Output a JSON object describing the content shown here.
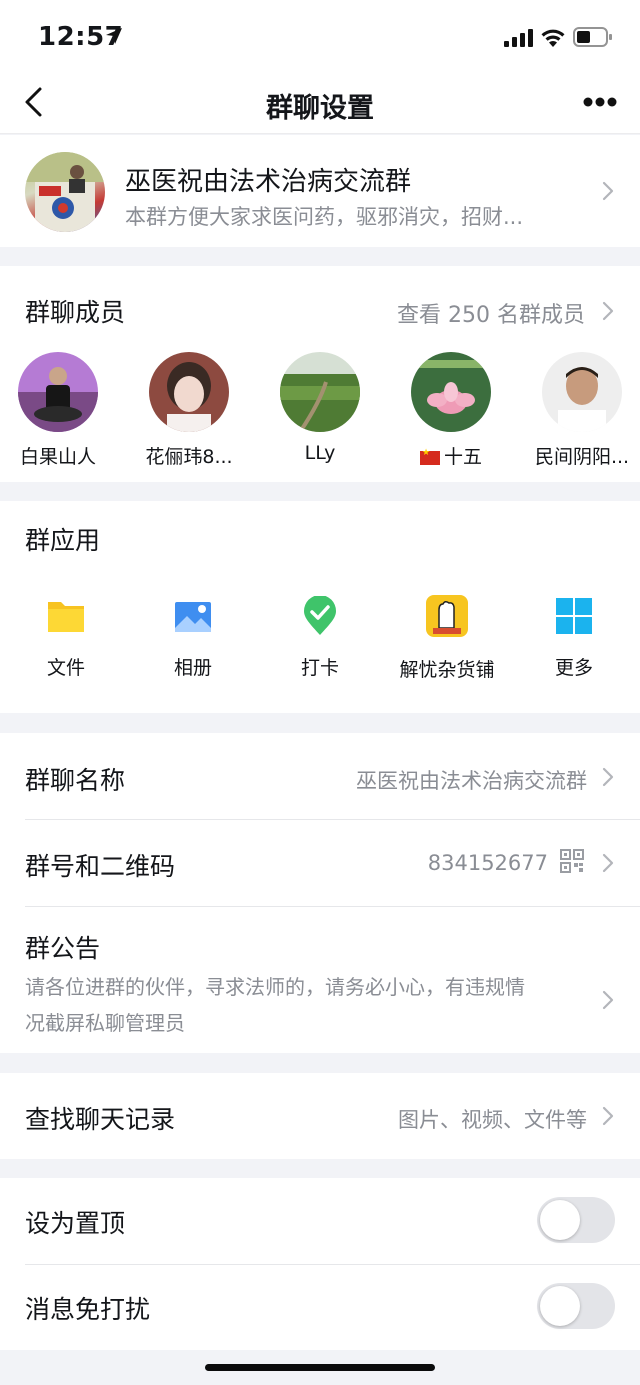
{
  "status_bar": {
    "time": "12:57"
  },
  "nav": {
    "title": "群聊设置"
  },
  "group": {
    "name": "巫医祝由法术治病交流群",
    "description": "本群方便大家求医问药，驱邪消灾，招财..."
  },
  "members": {
    "title": "群聊成员",
    "view_all": "查看 250 名群成员",
    "list": [
      {
        "name": "白果山人"
      },
      {
        "name": "花俪玮8..."
      },
      {
        "name": "LLy"
      },
      {
        "name": "十五"
      },
      {
        "name": "民间阴阳..."
      }
    ]
  },
  "apps": {
    "title": "群应用",
    "items": [
      {
        "label": "文件"
      },
      {
        "label": "相册"
      },
      {
        "label": "打卡"
      },
      {
        "label": "解忧杂货铺"
      },
      {
        "label": "更多"
      }
    ]
  },
  "settings": {
    "group_name_label": "群聊名称",
    "group_name_value": "巫医祝由法术治病交流群",
    "group_id_label": "群号和二维码",
    "group_id_value": "834152677",
    "notice_label": "群公告",
    "notice_text_1": "请各位进群的伙伴，寻求法师的，请务必小心，有违规情",
    "notice_text_2": "况截屏私聊管理员",
    "search_label": "查找聊天记录",
    "search_value": "图片、视频、文件等",
    "pin_label": "设为置顶",
    "pin_on": false,
    "mute_label": "消息免打扰",
    "mute_on": false
  },
  "colors": {
    "toggle_off": "#e3e4e8",
    "secondary_text": "#8a8d94",
    "background": "#f2f3f7"
  }
}
